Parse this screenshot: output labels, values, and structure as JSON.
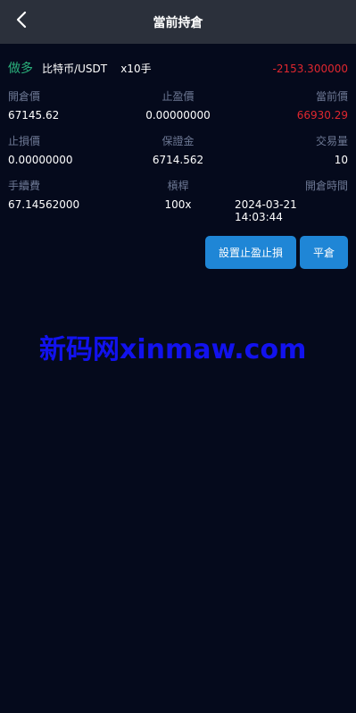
{
  "header": {
    "title": "當前持倉",
    "back_icon": "chevron-left-icon"
  },
  "position": {
    "direction": "做多",
    "pair": "比特币/USDT",
    "leverage": "x10手",
    "pnl": "-2153.300000",
    "open_price_label": "開倉價",
    "open_price": "67145.62",
    "take_profit_label": "止盈價",
    "take_profit": "0.00000000",
    "current_price_label": "當前價",
    "current_price": "66930.29",
    "stop_loss_label": "止損價",
    "stop_loss": "0.00000000",
    "margin_label": "保證金",
    "margin": "6714.562",
    "volume_label": "交易量",
    "volume": "10",
    "fee_label": "手續費",
    "fee": "67.14562000",
    "leverage_label": "槓桿",
    "leverage_value": "100x",
    "open_time_label": "開倉時間",
    "open_time": "2024-03-21 14:03:44"
  },
  "actions": {
    "set_tp_sl": "設置止盈止損",
    "close_position": "平倉"
  },
  "watermark": {
    "text": "新码网xinmaw.com"
  },
  "colors": {
    "header_bg": "#2b303b",
    "page_bg": "#050a1c",
    "long_green": "#2ab07b",
    "loss_red": "#e0272f",
    "button_blue": "#1f86d6",
    "label_gray": "#6d7894",
    "watermark_blue": "#1212ee"
  }
}
